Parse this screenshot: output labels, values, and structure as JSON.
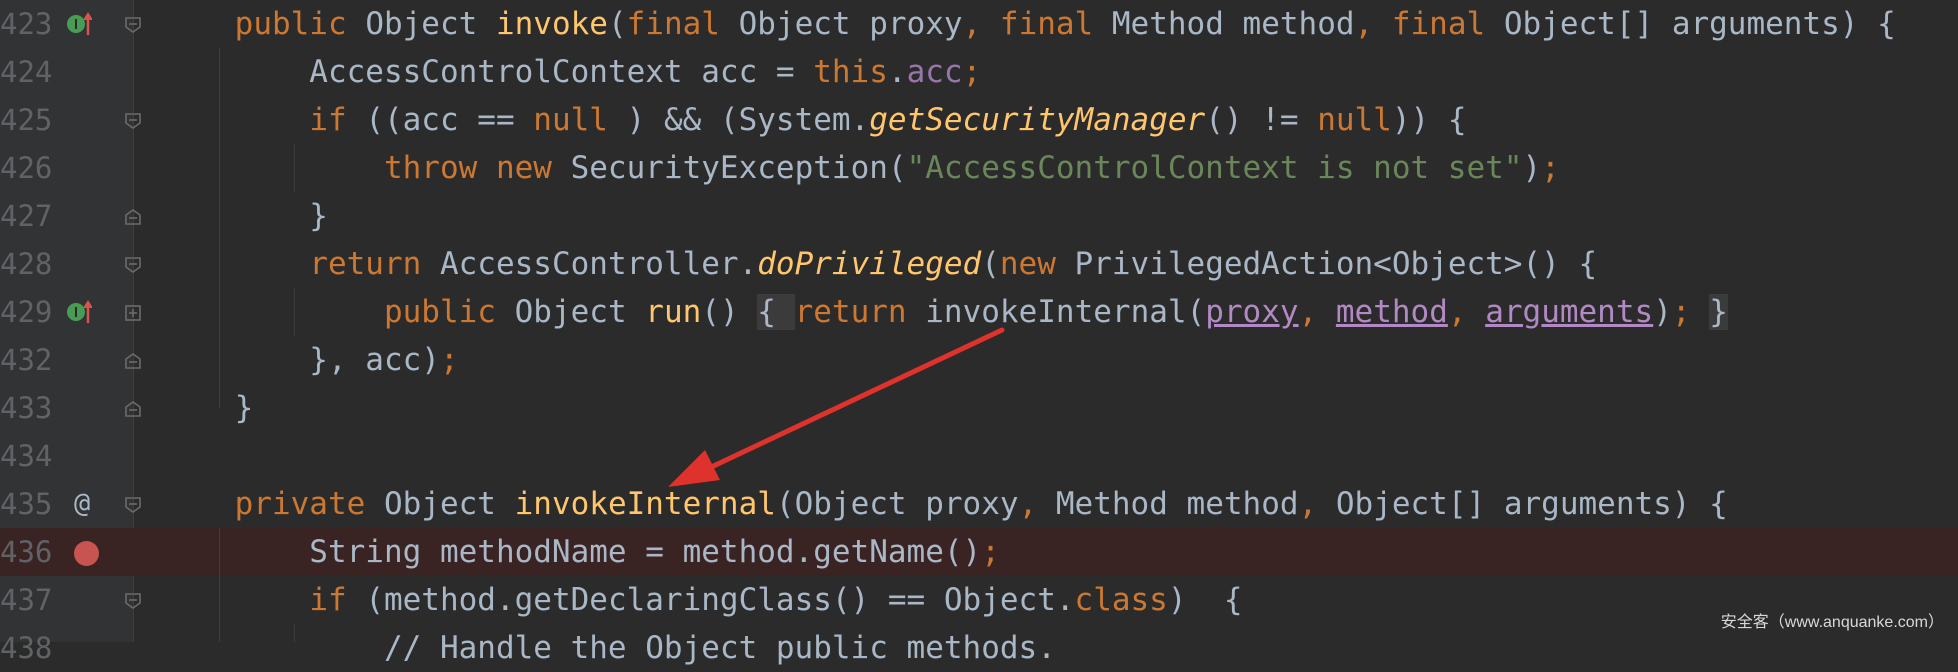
{
  "lines": [
    {
      "num": "423",
      "marker": "implements",
      "fold": "open",
      "tokens": [
        [
          "",
          "    "
        ],
        [
          "kw",
          "public "
        ],
        [
          "",
          "Object "
        ],
        [
          "fn",
          "invoke"
        ],
        [
          "",
          "("
        ],
        [
          "kw",
          "final "
        ],
        [
          "",
          "Object proxy"
        ],
        [
          "kw",
          ", "
        ],
        [
          "kw",
          "final "
        ],
        [
          "",
          "Method method"
        ],
        [
          "kw",
          ", "
        ],
        [
          "kw",
          "final "
        ],
        [
          "",
          "Object[] arguments) {"
        ]
      ]
    },
    {
      "num": "424",
      "marker": "",
      "fold": "none",
      "tokens": [
        [
          "",
          "        AccessControlContext acc = "
        ],
        [
          "kw",
          "this"
        ],
        [
          "",
          "."
        ],
        [
          "fld",
          "acc"
        ],
        [
          "kw",
          ";"
        ]
      ]
    },
    {
      "num": "425",
      "marker": "",
      "fold": "open",
      "tokens": [
        [
          "",
          "        "
        ],
        [
          "kw",
          "if "
        ],
        [
          "",
          "((acc == "
        ],
        [
          "kw",
          "null"
        ],
        [
          "",
          " ) && (System."
        ],
        [
          "fn it",
          "getSecurityManager"
        ],
        [
          "",
          "() != "
        ],
        [
          "kw",
          "null"
        ],
        [
          "",
          ")) {"
        ]
      ]
    },
    {
      "num": "426",
      "marker": "",
      "fold": "none",
      "tokens": [
        [
          "",
          "            "
        ],
        [
          "kw",
          "throw new "
        ],
        [
          "",
          "SecurityException("
        ],
        [
          "str",
          "\"AccessControlContext is not set\""
        ],
        [
          "",
          ")"
        ],
        [
          "kw",
          ";"
        ]
      ]
    },
    {
      "num": "427",
      "marker": "",
      "fold": "close",
      "tokens": [
        [
          "",
          "        }"
        ]
      ]
    },
    {
      "num": "428",
      "marker": "",
      "fold": "open",
      "tokens": [
        [
          "",
          "        "
        ],
        [
          "kw",
          "return "
        ],
        [
          "",
          "AccessController."
        ],
        [
          "fn it",
          "doPrivileged"
        ],
        [
          "",
          "("
        ],
        [
          "kw",
          "new "
        ],
        [
          "",
          "PrivilegedAction<Object>() {"
        ]
      ]
    },
    {
      "num": "429",
      "marker": "implements",
      "fold": "plus",
      "tokens": [
        [
          "",
          "            "
        ],
        [
          "kw",
          "public "
        ],
        [
          "",
          "Object "
        ],
        [
          "fn",
          "run"
        ],
        [
          "",
          "() "
        ],
        [
          "boxed",
          "{ "
        ],
        [
          "kw",
          "return "
        ],
        [
          "",
          "invokeInternal("
        ],
        [
          "param",
          "proxy"
        ],
        [
          "kw",
          ", "
        ],
        [
          "param",
          "method"
        ],
        [
          "kw",
          ", "
        ],
        [
          "param",
          "arguments"
        ],
        [
          "",
          ")"
        ],
        [
          "kw",
          ";"
        ],
        [
          "",
          " "
        ],
        [
          "boxed",
          "}"
        ]
      ]
    },
    {
      "num": "432",
      "marker": "",
      "fold": "close",
      "tokens": [
        [
          "",
          "        }, acc)"
        ],
        [
          "kw",
          ";"
        ]
      ]
    },
    {
      "num": "433",
      "marker": "",
      "fold": "close",
      "tokens": [
        [
          "",
          "    }"
        ]
      ]
    },
    {
      "num": "434",
      "marker": "",
      "fold": "none",
      "tokens": []
    },
    {
      "num": "435",
      "marker": "annotation",
      "fold": "open",
      "tokens": [
        [
          "",
          "    "
        ],
        [
          "kw",
          "private "
        ],
        [
          "",
          "Object "
        ],
        [
          "fn",
          "invokeInternal"
        ],
        [
          "",
          "(Object proxy"
        ],
        [
          "kw",
          ", "
        ],
        [
          "",
          "Method method"
        ],
        [
          "kw",
          ", "
        ],
        [
          "",
          "Object[] arguments) {"
        ]
      ]
    },
    {
      "num": "436",
      "marker": "breakpoint",
      "fold": "none",
      "tokens": [
        [
          "",
          "        String methodName = method.getName()"
        ],
        [
          "kw",
          ";"
        ]
      ]
    },
    {
      "num": "437",
      "marker": "",
      "fold": "open",
      "tokens": [
        [
          "",
          "        "
        ],
        [
          "kw",
          "if "
        ],
        [
          "",
          "(method.getDeclaringClass() == Object."
        ],
        [
          "kw",
          "class"
        ],
        [
          "",
          ")  {"
        ]
      ]
    },
    {
      "num": "438",
      "marker": "",
      "fold": "none",
      "tokens": [
        [
          "",
          "            // Handle the Object public methods."
        ]
      ]
    }
  ],
  "markers": {
    "annotation_symbol": "@"
  },
  "watermark": "安全客（www.anquanke.com）",
  "colors": {
    "background": "#2b2b2b",
    "gutter": "#313335",
    "keyword": "#cc7832",
    "function": "#ffc66d",
    "string": "#6a8759",
    "field": "#9876aa",
    "breakpoint": "#c75450",
    "arrow": "#e0322c"
  }
}
